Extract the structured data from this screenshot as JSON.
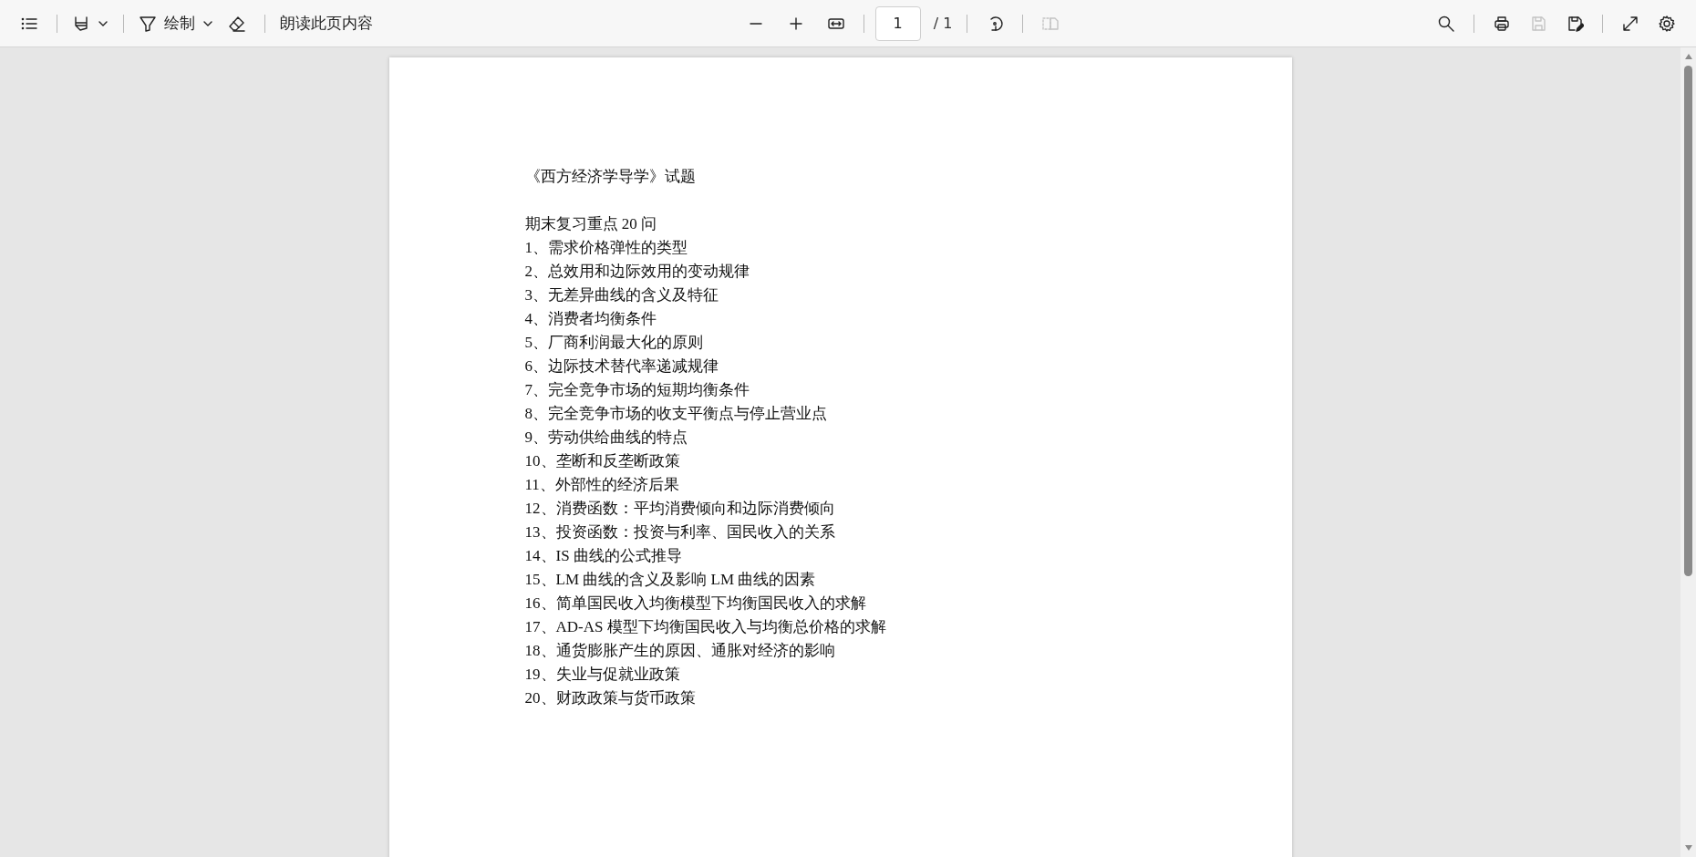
{
  "toolbar": {
    "draw_label": "绘制",
    "read_aloud": "朗读此页内容",
    "page_input": {
      "value": "1"
    },
    "page_total": "/ 1",
    "view_tools": [
      {
        "kind": "zoom-out",
        "disabled": false
      },
      {
        "kind": "zoom-in",
        "disabled": false
      },
      {
        "kind": "fit-width",
        "disabled": false
      }
    ],
    "page_tools": [
      {
        "kind": "rotate",
        "disabled": false
      },
      {
        "kind": "two-page",
        "disabled": true
      }
    ],
    "right_tools": [
      {
        "kind": "search",
        "disabled": false
      },
      {
        "kind": "print",
        "disabled": false
      },
      {
        "kind": "save",
        "disabled": true
      },
      {
        "kind": "save-as",
        "disabled": false
      },
      {
        "kind": "fullscreen",
        "disabled": false
      },
      {
        "kind": "settings",
        "disabled": false
      }
    ]
  },
  "document": {
    "title": "《西方经济学导学》试题",
    "subtitle": "期末复习重点 20 问",
    "items": [
      "1、需求价格弹性的类型",
      "2、总效用和边际效用的变动规律",
      "3、无差异曲线的含义及特征",
      "4、消费者均衡条件",
      "5、厂商利润最大化的原则",
      "6、边际技术替代率递减规律",
      "7、完全竞争市场的短期均衡条件",
      "8、完全竞争市场的收支平衡点与停止营业点",
      "9、劳动供给曲线的特点",
      "10、垄断和反垄断政策",
      "11、外部性的经济后果",
      "12、消费函数：平均消费倾向和边际消费倾向",
      "13、投资函数：投资与利率、国民收入的关系",
      "14、IS 曲线的公式推导",
      "15、LM 曲线的含义及影响 LM 曲线的因素",
      "16、简单国民收入均衡模型下均衡国民收入的求解",
      "17、AD-AS 模型下均衡国民收入与均衡总价格的求解",
      "18、通货膨胀产生的原因、通胀对经济的影响",
      "19、失业与促就业政策",
      "20、财政政策与货币政策"
    ]
  }
}
